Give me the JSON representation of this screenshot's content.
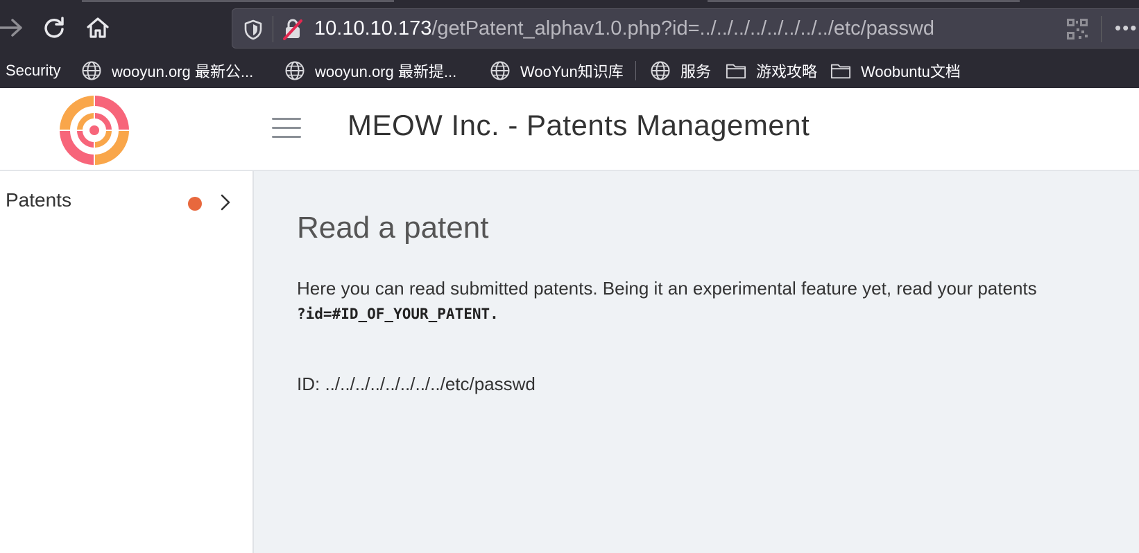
{
  "browser": {
    "url_host": "10.10.10.173",
    "url_path": "/getPatent_alphav1.0.php?id=../../../../../../../../etc/passwd",
    "more_label": "•••",
    "bookmarks": [
      {
        "label": "Security",
        "icon": "none"
      },
      {
        "label": "wooyun.org 最新公...",
        "icon": "globe-icon"
      },
      {
        "label": "wooyun.org 最新提...",
        "icon": "globe-icon"
      },
      {
        "label": "WooYun知识库",
        "icon": "globe-icon"
      },
      {
        "label": "服务",
        "icon": "globe-icon"
      },
      {
        "label": "游戏攻略",
        "icon": "folder-icon"
      },
      {
        "label": "Woobuntu文档",
        "icon": "folder-icon"
      }
    ]
  },
  "header": {
    "title": "MEOW Inc. - Patents Management"
  },
  "sidebar": {
    "items": [
      {
        "label": "Patents",
        "badge_color": "#e8683d"
      }
    ]
  },
  "main": {
    "heading": "Read a patent",
    "description": "Here you can read submitted patents. Being it an experimental feature yet, read your patents",
    "code_hint": "?id=#ID_OF_YOUR_PATENT.",
    "id_label": "ID: ../../../../../../../../etc/passwd"
  },
  "colors": {
    "chrome_bg": "#2b2a33",
    "urlbar_bg": "#42414d",
    "main_bg": "#eff2f5",
    "logo_pink": "#f7657a",
    "logo_orange": "#f9a64a",
    "badge": "#e8683d"
  }
}
